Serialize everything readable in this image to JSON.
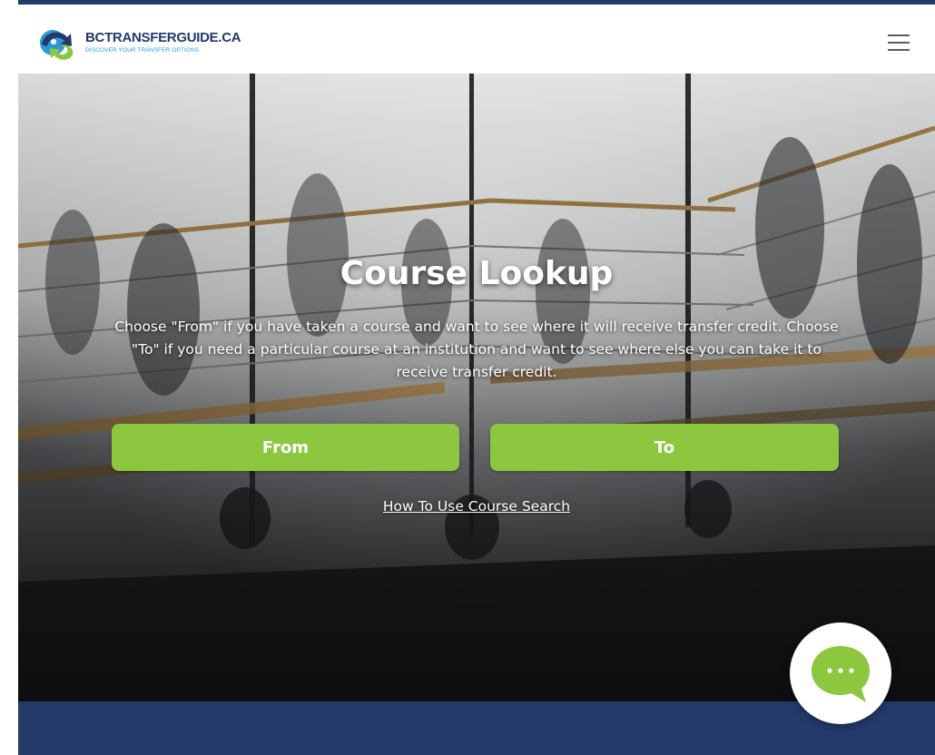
{
  "header": {
    "logo_title": "BCTRANSFERGUIDE.CA",
    "logo_tagline": "DISCOVER YOUR TRANSFER OPTIONS",
    "menu_icon": "hamburger-menu-icon"
  },
  "hero": {
    "title": "Course Lookup",
    "description": "Choose \"From\" if you have taken a course and want to see where it will receive transfer credit. Choose \"To\" if you need a particular course at an institution and want to see where else you can take it to receive transfer credit.",
    "from_label": "From",
    "to_label": "To",
    "howto_link": "How To Use Course Search"
  },
  "chat": {
    "icon": "chat-bubble-icon"
  },
  "colors": {
    "brand_navy": "#233a6b",
    "accent_green": "#8dc63f",
    "logo_blue": "#2c9ad7"
  }
}
